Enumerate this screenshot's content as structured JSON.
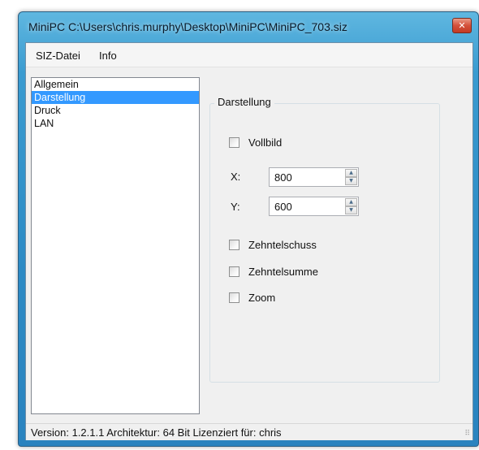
{
  "window": {
    "title": "MiniPC C:\\Users\\chris.murphy\\Desktop\\MiniPC\\MiniPC_703.siz",
    "close_glyph": "✕"
  },
  "menu": {
    "items": [
      "SIZ-Datei",
      "Info"
    ]
  },
  "sidebar": {
    "items": [
      {
        "label": "Allgemein",
        "selected": false
      },
      {
        "label": "Darstellung",
        "selected": true
      },
      {
        "label": "Druck",
        "selected": false
      },
      {
        "label": "LAN",
        "selected": false
      }
    ]
  },
  "panel": {
    "group_title": "Darstellung",
    "vollbild": {
      "label": "Vollbild",
      "checked": false
    },
    "x": {
      "label": "X:",
      "value": "800"
    },
    "y": {
      "label": "Y:",
      "value": "600"
    },
    "zehntelschuss": {
      "label": "Zehntelschuss",
      "checked": false
    },
    "zehntelsumme": {
      "label": "Zehntelsumme",
      "checked": false
    },
    "zoom": {
      "label": "Zoom",
      "checked": false
    }
  },
  "status": {
    "text": "Version: 1.2.1.1 Architektur: 64 Bit Lizenziert für: chris"
  },
  "icons": {
    "spin_up": "▲",
    "spin_down": "▼",
    "grip": "⠿"
  },
  "colors": {
    "selection": "#3399ff",
    "title_gradient_top": "#5fb7e0",
    "title_gradient_bottom": "#2a83bf",
    "close_button": "#d4503a"
  }
}
